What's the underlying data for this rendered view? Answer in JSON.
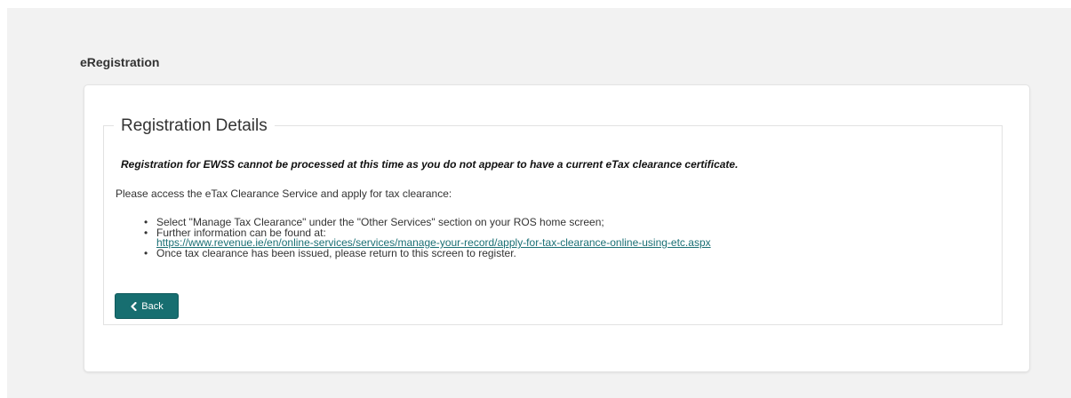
{
  "app": {
    "title": "eRegistration"
  },
  "section": {
    "legend": "Registration Details",
    "warning": "Registration for EWSS cannot be processed at this time as you do not appear to have a current eTax clearance certificate.",
    "instruction": "Please access the eTax Clearance Service and apply for tax clearance:",
    "bullets": [
      "Select \"Manage Tax Clearance\" under the \"Other Services\" section on your ROS home screen;",
      "Further information can be found at:",
      "Once tax clearance has been issued, please return to this screen to register."
    ],
    "link_text": "https://www.revenue.ie/en/online-services/services/manage-your-record/apply-for-tax-clearance-online-using-etc.aspx"
  },
  "buttons": {
    "back_label": "Back",
    "back_icon": "chevron-left-icon"
  },
  "colors": {
    "primary_button": "#176e70",
    "link": "#1a6f74",
    "page_background": "#f2f2f2"
  }
}
